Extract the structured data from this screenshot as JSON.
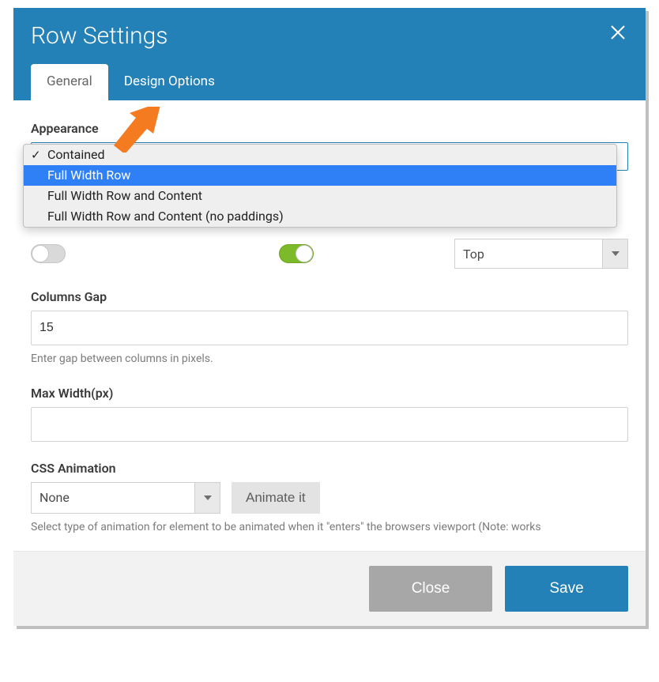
{
  "modal": {
    "title": "Row Settings",
    "tabs": [
      {
        "label": "General",
        "active": true
      },
      {
        "label": "Design Options",
        "active": false
      }
    ]
  },
  "appearance": {
    "label": "Appearance",
    "options": [
      "Contained",
      "Full Width Row",
      "Full Width Row and Content",
      "Full Width Row and Content (no paddings)"
    ],
    "checked_index": 0,
    "highlight_index": 1
  },
  "top_select": {
    "value": "Top"
  },
  "columns_gap": {
    "label": "Columns Gap",
    "value": "15",
    "help": "Enter gap between columns in pixels."
  },
  "max_width": {
    "label": "Max Width(px)",
    "value": ""
  },
  "css_animation": {
    "label": "CSS Animation",
    "value": "None",
    "animate_btn": "Animate it",
    "help": "Select type of animation for element to be animated when it \"enters\" the browsers viewport (Note: works"
  },
  "footer": {
    "close": "Close",
    "save": "Save"
  }
}
